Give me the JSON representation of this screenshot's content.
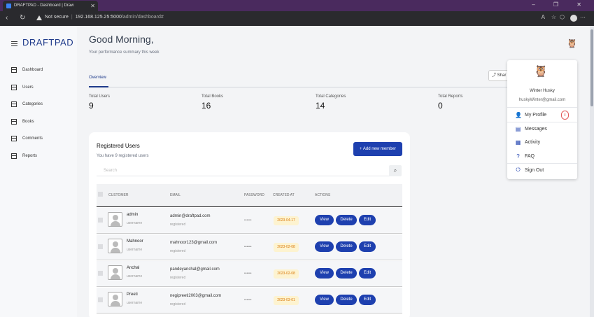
{
  "browser": {
    "tab_title": "DRAFTPAD - Dashboard | Draw",
    "security_label": "Not secure",
    "host": "192.168.125.25:5000",
    "path": "/admin/dashboard#",
    "window_controls": "–  ❐  ✕"
  },
  "sidebar": {
    "brand": "DRAFTPAD",
    "items": [
      {
        "label": "Dashboard"
      },
      {
        "label": "Users"
      },
      {
        "label": "Categories"
      },
      {
        "label": "Books"
      },
      {
        "label": "Comments"
      },
      {
        "label": "Reports"
      }
    ]
  },
  "header": {
    "greeting": "Good Morning,",
    "subtitle": "Your performance summary this week"
  },
  "tabs": {
    "overview": "Overview",
    "share_label": "Shar"
  },
  "stats": [
    {
      "label": "Total Users",
      "value": "9"
    },
    {
      "label": "Total Books",
      "value": "16"
    },
    {
      "label": "Total Categories",
      "value": "14"
    },
    {
      "label": "Total Reports",
      "value": "0"
    }
  ],
  "users_card": {
    "title": "Registered Users",
    "subtitle": "You have 9 registered users",
    "add_button": "Add new member",
    "search_placeholder": "Search",
    "columns": [
      "CUSTOMER",
      "EMAIL",
      "PASSWORD",
      "CREATED AT",
      "ACTIONS"
    ],
    "rows": [
      {
        "name": "admin",
        "username": "username",
        "email": "admin@draftpad.com",
        "status": "registered",
        "password": "••••••",
        "created": "2023-04-17"
      },
      {
        "name": "Mahnoor",
        "username": "username",
        "email": "mahnoor123@gmail.com",
        "status": "registered",
        "password": "••••••",
        "created": "2023-02-08"
      },
      {
        "name": "Anchal",
        "username": "username",
        "email": "pandeyanchal@gmail.com",
        "status": "registered",
        "password": "••••••",
        "created": "2023-02-08"
      },
      {
        "name": "Preeti",
        "username": "username",
        "email": "negipreeti2003@gmail.com",
        "status": "registered",
        "password": "••••••",
        "created": "2023-03-01"
      }
    ],
    "actions": {
      "view": "View",
      "delete": "Delete",
      "edit": "Edit"
    }
  },
  "profile_menu": {
    "name": "Winter Husky",
    "email": "huskyWinter@gmail.com",
    "items": [
      {
        "label": "My Profile",
        "icon": "user-icon"
      },
      {
        "label": "Messages",
        "icon": "message-icon"
      },
      {
        "label": "Activity",
        "icon": "activity-icon"
      },
      {
        "label": "FAQ",
        "icon": "help-icon"
      },
      {
        "label": "Sign Out",
        "icon": "power-icon"
      }
    ]
  },
  "colors": {
    "brand": "#1e3a8a",
    "button": "#1e40af",
    "date_badge_bg": "#fdf3d0",
    "date_badge_text": "#d97706"
  }
}
